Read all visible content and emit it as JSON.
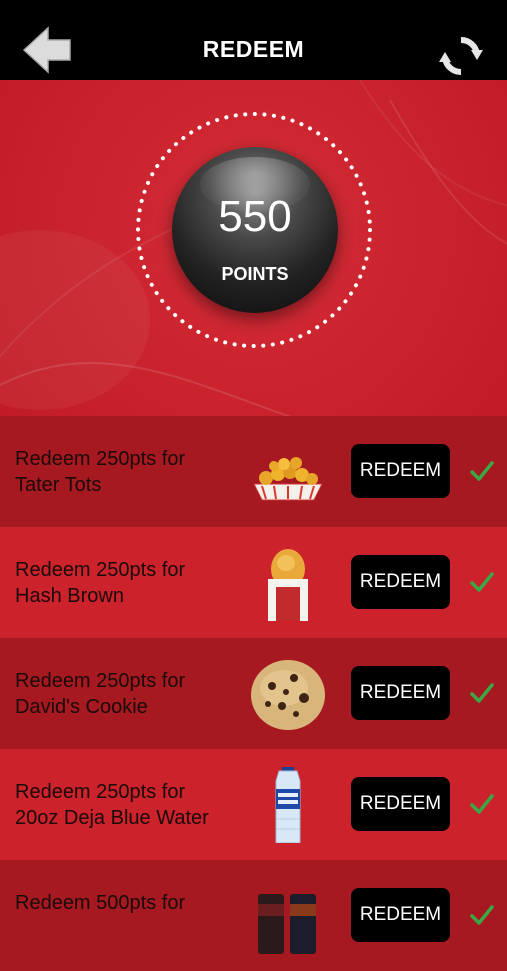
{
  "header": {
    "title": "REDEEM",
    "back_icon": "back-arrow-icon",
    "refresh_icon": "refresh-icon"
  },
  "points": {
    "value": "550",
    "label": "POINTS"
  },
  "rewards": [
    {
      "line1": "Redeem 250pts for",
      "line2": "Tater Tots",
      "button": "REDEEM",
      "image": "tater-tots-image",
      "checked": true
    },
    {
      "line1": "Redeem 250pts for",
      "line2": "Hash Brown",
      "button": "REDEEM",
      "image": "hash-brown-image",
      "checked": true
    },
    {
      "line1": "Redeem 250pts for",
      "line2": "David's Cookie",
      "button": "REDEEM",
      "image": "cookie-image",
      "checked": true
    },
    {
      "line1": "Redeem 250pts for",
      "line2": "20oz Deja Blue Water",
      "button": "REDEEM",
      "image": "water-bottle-image",
      "checked": true
    },
    {
      "line1": "Redeem 500pts for",
      "line2": "",
      "button": "REDEEM",
      "image": "energy-drink-cans-image",
      "checked": true
    }
  ],
  "colors": {
    "background_red": "#c91f28",
    "row_dark": "#a71920",
    "row_light": "#cb222b",
    "check_green": "#3aa845",
    "header_black": "#000000"
  }
}
